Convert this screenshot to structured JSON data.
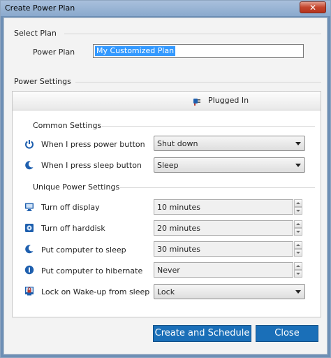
{
  "window": {
    "title": "Create Power Plan",
    "close_glyph": "✕"
  },
  "select_plan": {
    "heading": "Select Plan",
    "power_plan_label": "Power Plan",
    "power_plan_value": "My Customized Plan"
  },
  "power_settings": {
    "heading": "Power Settings",
    "plugged_in_label": "Plugged In",
    "common_heading": "Common Settings",
    "unique_heading": "Unique Power Settings",
    "rows": [
      {
        "label": "When I press power button",
        "value": "Shut down",
        "icon": "power-icon"
      },
      {
        "label": "When I press sleep button",
        "value": "Sleep",
        "icon": "moon-icon"
      },
      {
        "label": "Turn off display",
        "value": "10 minutes",
        "icon": "monitor-icon"
      },
      {
        "label": "Turn off harddisk",
        "value": "20 minutes",
        "icon": "harddisk-icon"
      },
      {
        "label": "Put computer to sleep",
        "value": "30 minutes",
        "icon": "moon-icon"
      },
      {
        "label": "Put computer to hibernate",
        "value": "Never",
        "icon": "hibernate-icon"
      },
      {
        "label": "Lock on Wake-up from sleep",
        "value": "Lock",
        "icon": "lock-icon"
      }
    ]
  },
  "buttons": {
    "create": "Create and Schedule",
    "close": "Close"
  },
  "colors": {
    "accent": "#1a6fb8",
    "icon_blue": "#1e5fae",
    "selection": "#3399ff"
  }
}
